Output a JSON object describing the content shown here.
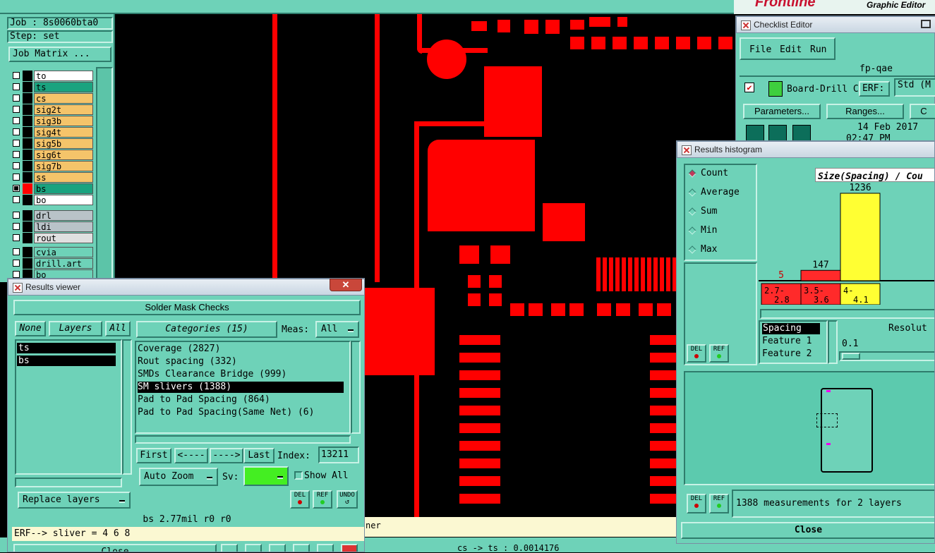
{
  "job_panel": {
    "job": "Job : 8s0060bta0",
    "step": "Step: set",
    "matrix_button": "Job Matrix ...",
    "layers": [
      {
        "name": "to",
        "color": "#ffffff"
      },
      {
        "name": "ts",
        "color": "#1aa37f"
      },
      {
        "name": "cs",
        "color": "#f5c46a"
      },
      {
        "name": "sig2t",
        "color": "#f5c46a"
      },
      {
        "name": "sig3b",
        "color": "#f5c46a"
      },
      {
        "name": "sig4t",
        "color": "#f5c46a"
      },
      {
        "name": "sig5b",
        "color": "#f5c46a"
      },
      {
        "name": "sig6t",
        "color": "#f5c46a"
      },
      {
        "name": "sig7b",
        "color": "#f5c46a"
      },
      {
        "name": "ss",
        "color": "#f5c46a"
      },
      {
        "name": "bs",
        "color": "#1aa37f"
      },
      {
        "name": "bo",
        "color": "#ffffff"
      }
    ],
    "layers2": [
      {
        "name": "drl",
        "color": "#b9c3c8"
      },
      {
        "name": "ldi",
        "color": "#b9c3c8"
      },
      {
        "name": "rout",
        "color": "#e0e0e0"
      }
    ],
    "layers3": [
      {
        "name": "cvia",
        "color": "#6ed2b8"
      },
      {
        "name": "drill.art",
        "color": "#6ed2b8"
      },
      {
        "name": "bo",
        "color": "#6ed2b8"
      }
    ]
  },
  "header": {
    "brand": "Frontline",
    "subtitle": "Graphic Editor"
  },
  "results_viewer": {
    "title": "Results viewer",
    "banner": "Solder Mask Checks",
    "none_btn": "None",
    "layers_label": "Layers",
    "all_btn": "All",
    "layers": [
      "ts",
      "bs"
    ],
    "categories_label": "Categories (15)",
    "meas_label": "Meas:",
    "meas_value": "All",
    "categories": [
      "Coverage (2827)",
      "Rout spacing (332)",
      "SMDs Clearance Bridge (999)",
      "SM slivers (1388)",
      "Pad to Pad Spacing (864)",
      "Pad to Pad Spacing(Same Net) (6)"
    ],
    "first_btn": "First",
    "prev_btn": "<----",
    "next_btn": "---->",
    "last_btn": "Last",
    "index_label": "Index:",
    "index_value": "13211",
    "zoom_value": "Auto Zoom",
    "sv_label": "Sv:",
    "show_all": "Show All",
    "replace_layers": "Replace layers",
    "del": "DEL",
    "ref": "REF",
    "undo": "UNDO",
    "status": "bs 2.77mil  r0  r0",
    "erf_line": "ERF--> sliver = 4 6 8",
    "close_btn": "Close"
  },
  "bottom_status": {
    "coords": "cs -> ts : 0.0014176",
    "partial": "ner"
  },
  "checklist": {
    "title": "Checklist Editor",
    "menu": [
      "File",
      "Edit",
      "Run"
    ],
    "name": "fp-qae",
    "row_label": "Board-Drill Che",
    "erf_label": "ERF:",
    "erf_value": "Std (M",
    "params_btn": "Parameters...",
    "ranges_btn": "Ranges...",
    "third_btn": "C",
    "date": "14 Feb 2017",
    "time": "02:47 PM"
  },
  "histogram": {
    "title": "Results histogram",
    "options": [
      "Count",
      "Average",
      "Sum",
      "Min",
      "Max"
    ],
    "selected": "Count",
    "chart_title": "Size(Spacing) / Cou",
    "list": [
      "Spacing",
      "Feature 1",
      "Feature 2"
    ],
    "resolution_label": "Resolut",
    "resolution_value": "0.1",
    "del": "DEL",
    "ref": "REF",
    "measurements": "1388 measurements for 2 layers",
    "close_btn": "Close"
  },
  "chart_data": {
    "type": "bar",
    "title": "Size(Spacing) / Cou",
    "categories": [
      "2.7-2.8",
      "3.5-3.6",
      "4-4.1"
    ],
    "values": [
      5,
      147,
      1236
    ],
    "colors": [
      "#ff2a2a",
      "#ff2a2a",
      "#ffff33"
    ],
    "ylim": [
      0,
      1236
    ]
  }
}
